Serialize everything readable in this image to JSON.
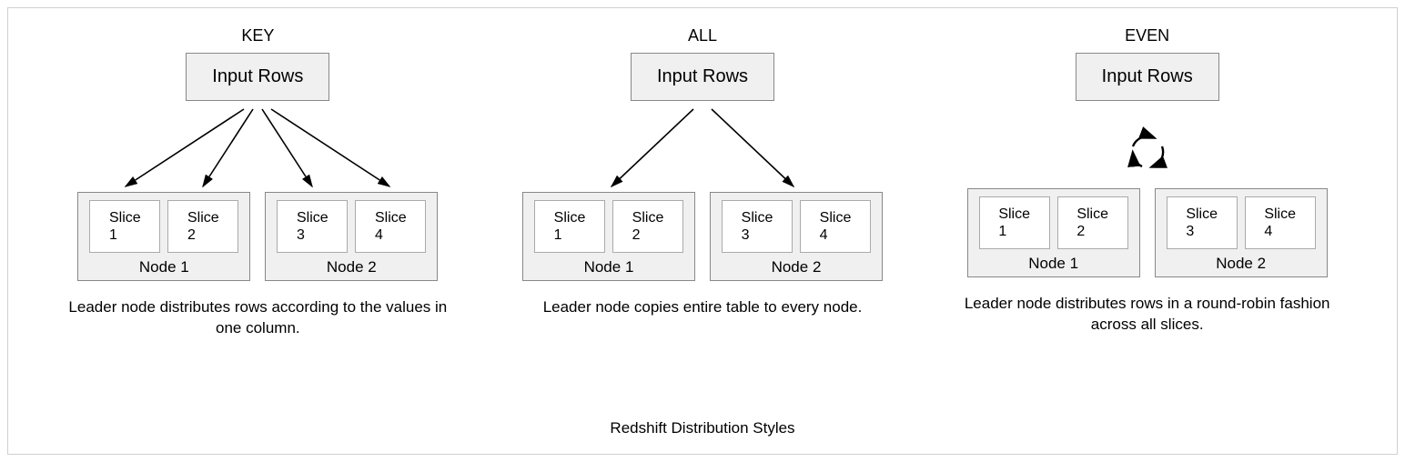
{
  "caption": "Redshift Distribution Styles",
  "columns": [
    {
      "title": "KEY",
      "input_label": "Input Rows",
      "nodes": [
        {
          "label": "Node 1",
          "slices": [
            "Slice\n1",
            "Slice\n2"
          ]
        },
        {
          "label": "Node 2",
          "slices": [
            "Slice\n3",
            "Slice\n4"
          ]
        }
      ],
      "description": "Leader node distributes rows according to the values in one column."
    },
    {
      "title": "ALL",
      "input_label": "Input Rows",
      "nodes": [
        {
          "label": "Node 1",
          "slices": [
            "Slice\n1",
            "Slice\n2"
          ]
        },
        {
          "label": "Node 2",
          "slices": [
            "Slice\n3",
            "Slice\n4"
          ]
        }
      ],
      "description": "Leader node copies entire table to every node."
    },
    {
      "title": "EVEN",
      "input_label": "Input Rows",
      "nodes": [
        {
          "label": "Node 1",
          "slices": [
            "Slice\n1",
            "Slice\n2"
          ]
        },
        {
          "label": "Node 2",
          "slices": [
            "Slice\n3",
            "Slice\n4"
          ]
        }
      ],
      "description": "Leader node distributes rows in a round-robin fashion across all slices."
    }
  ]
}
